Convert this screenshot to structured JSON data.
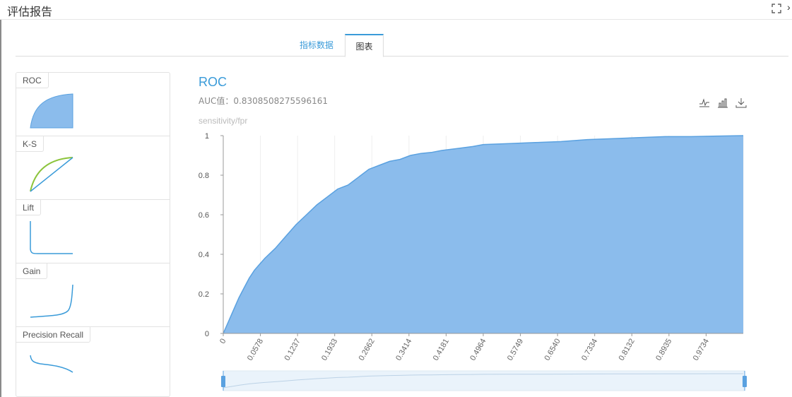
{
  "window": {
    "title": "评估报告"
  },
  "tabs": [
    {
      "label": "指标数据",
      "active": false
    },
    {
      "label": "图表",
      "active": true
    }
  ],
  "side_cards": [
    {
      "label": "ROC"
    },
    {
      "label": "K-S"
    },
    {
      "label": "Lift"
    },
    {
      "label": "Gain"
    },
    {
      "label": "Precision Recall"
    }
  ],
  "main": {
    "title": "ROC",
    "auc_text": "AUC值：0.8308508275596161"
  },
  "colors": {
    "accent": "#3a9bd9",
    "area_fill": "#8bbcec",
    "area_line": "#5aa1e0",
    "ks_green": "#8cc43c"
  },
  "toolbar": {
    "icons": [
      "line-chart-icon",
      "bar-chart-icon",
      "download-icon"
    ]
  },
  "chart_data": {
    "type": "area",
    "title": "ROC",
    "ylabel": "sensitivity/fpr",
    "xlabel": "",
    "x_tick_labels": [
      "0",
      "0.0578",
      "0.1237",
      "0.1933",
      "0.2662",
      "0.3414",
      "0.4181",
      "0.4964",
      "0.5749",
      "0.6540",
      "0.7334",
      "0.8132",
      "0.8935",
      "0.9734"
    ],
    "y_ticks": [
      0,
      0.2,
      0.4,
      0.6,
      0.8,
      1
    ],
    "ylim": [
      0,
      1
    ],
    "grid": "vertical",
    "series": [
      {
        "x": [
          0,
          0.01,
          0.02,
          0.03,
          0.04,
          0.05,
          0.06,
          0.07,
          0.08,
          0.1,
          0.12,
          0.14,
          0.16,
          0.18,
          0.2,
          0.22,
          0.24,
          0.26,
          0.28,
          0.3,
          0.32,
          0.34,
          0.36,
          0.38,
          0.4,
          0.42,
          0.45,
          0.48,
          0.5,
          0.55,
          0.6,
          0.65,
          0.7,
          0.75,
          0.8,
          0.85,
          0.9,
          0.95,
          1.0
        ],
        "y": [
          0,
          0.06,
          0.12,
          0.18,
          0.23,
          0.28,
          0.32,
          0.35,
          0.38,
          0.43,
          0.49,
          0.55,
          0.6,
          0.65,
          0.69,
          0.73,
          0.75,
          0.79,
          0.83,
          0.85,
          0.87,
          0.88,
          0.9,
          0.91,
          0.915,
          0.925,
          0.935,
          0.945,
          0.955,
          0.96,
          0.965,
          0.97,
          0.98,
          0.985,
          0.99,
          0.995,
          0.995,
          0.998,
          1.0
        ]
      }
    ]
  }
}
